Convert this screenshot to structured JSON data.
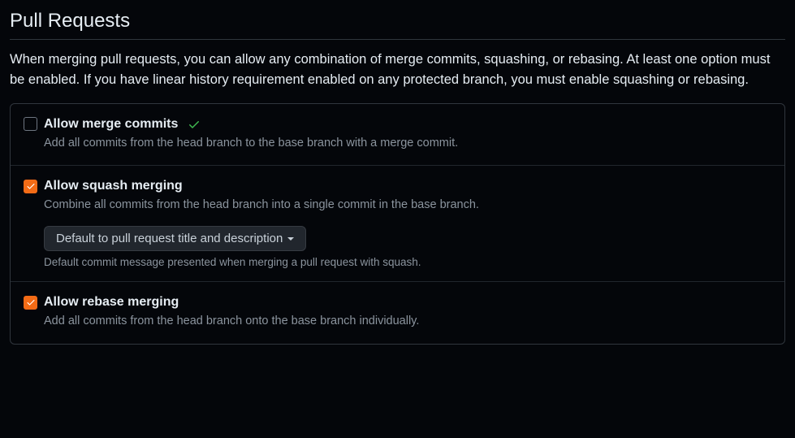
{
  "section": {
    "title": "Pull Requests",
    "description": "When merging pull requests, you can allow any combination of merge commits, squashing, or rebasing. At least one option must be enabled. If you have linear history requirement enabled on any protected branch, you must enable squashing or rebasing."
  },
  "options": {
    "merge_commits": {
      "checked": false,
      "label": "Allow merge commits",
      "description": "Add all commits from the head branch to the base branch with a merge commit.",
      "recently_saved": true
    },
    "squash_merging": {
      "checked": true,
      "label": "Allow squash merging",
      "description": "Combine all commits from the head branch into a single commit in the base branch.",
      "dropdown_selected": "Default to pull request title and description",
      "dropdown_help": "Default commit message presented when merging a pull request with squash."
    },
    "rebase_merging": {
      "checked": true,
      "label": "Allow rebase merging",
      "description": "Add all commits from the head branch onto the base branch individually."
    }
  }
}
